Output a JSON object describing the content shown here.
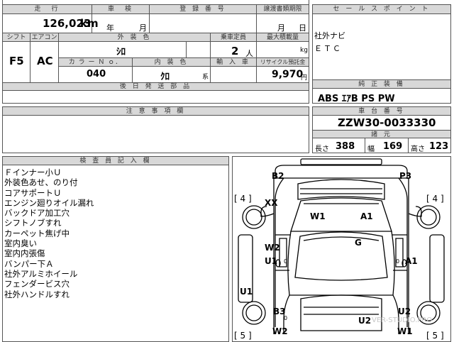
{
  "top_fields": {
    "mileage_label": "走　行",
    "mileage_value": "126,023",
    "mileage_unit": "km",
    "inspection_label": "車　検",
    "inspection_year": "年",
    "inspection_month": "月",
    "registration_label": "登 録 番 号",
    "transfer_deadline_label": "譲渡書類期限",
    "transfer_month": "月",
    "transfer_day": "日"
  },
  "row2": {
    "shift_label": "シフト",
    "shift_value": "F5",
    "ac_label": "エアコン",
    "ac_value": "AC",
    "exterior_color_label": "外 装 色",
    "exterior_color_value": "ｼﾛ",
    "capacity_label": "乗車定員",
    "capacity_value": "2",
    "capacity_unit": "人",
    "max_load_label": "最大積載量",
    "max_load_unit": "kg",
    "color_no_label": "カ ラ ー Ｎ ｏ．",
    "color_no_value": "040",
    "interior_color_label": "内 装 色",
    "interior_color_value": "ｸﾛ",
    "interior_color_suffix": "系",
    "import_label": "輸 入 車",
    "recycle_label": "リサイクル預託金",
    "recycle_value": "9,970",
    "recycle_unit": "円"
  },
  "later_docs_label": "後 日 発 送 部 品",
  "sales_point": {
    "header": "セ ー ル ス ポ イ ン ト",
    "lines": [
      "社外ナビ",
      "ＥＴＣ"
    ]
  },
  "genuine_equipment": {
    "header": "純 正 装 備",
    "value": "ABS ｴｱB PS PW"
  },
  "caution_label": "注 意 事 項 欄",
  "chassis": {
    "header": "車 台 番 号",
    "value": "ZZW30-0033330",
    "dims_header": "諸 元",
    "length_label": "長さ",
    "length_value": "388",
    "width_label": "幅",
    "width_value": "169",
    "height_label": "高さ",
    "height_value": "123"
  },
  "inspector": {
    "header": "検 査 員 記 入 欄",
    "notes": [
      "Ｆインナー小Ｕ",
      "外装色あせ、のり付",
      "コアサポートＵ",
      "エンジン廻りオイル漏れ",
      "バックドア加工穴",
      "シフトノブすれ",
      "カーペット焦げ中",
      "室内臭い",
      "室内内張傷",
      "バンパー下Ａ",
      "社外アルミホイール",
      "フェンダービス穴",
      "社外ハンドルすれ"
    ]
  },
  "diagram_marks": {
    "b2": "B2",
    "p3": "P3",
    "tire_fl": "[ 4 ]",
    "tire_fr": "[ 4 ]",
    "xx": "XX",
    "w1_hood": "W1",
    "a1_hood": "A1",
    "g": "G",
    "w2_left": "W2",
    "u1_left": "U1",
    "a1_right": "A1",
    "zero1": "0",
    "zero2": "0",
    "zero3": "0",
    "u1_sill": "U1",
    "b3": "B3",
    "u2_right": "U2",
    "u2_rear": "U2",
    "w2_rear": "W2",
    "w1_rear": "W1",
    "tire_rl": "[ 5 ]",
    "tire_rr": "[ 5 ]",
    "watermark": "VER-STUDIO.PRO"
  }
}
